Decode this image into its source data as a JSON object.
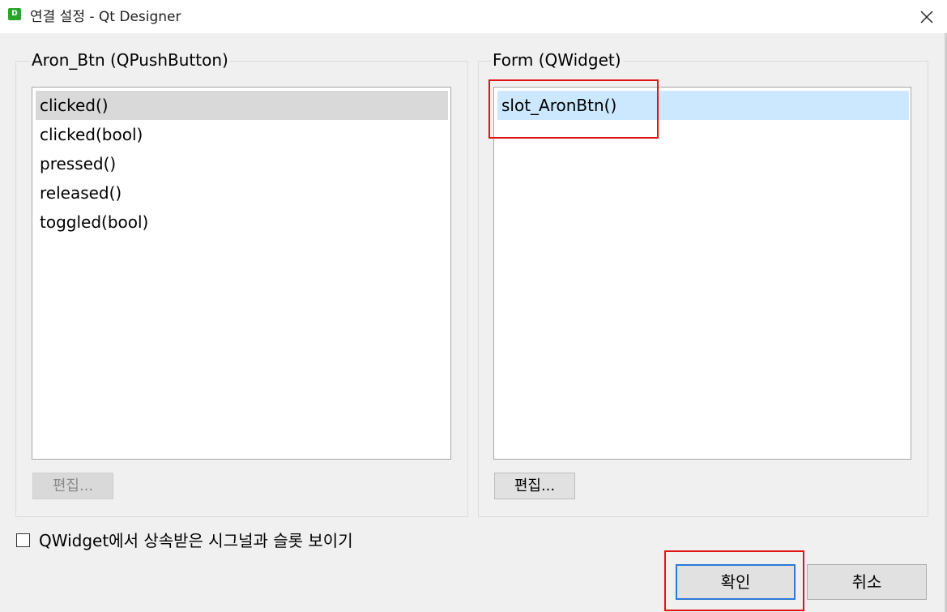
{
  "window": {
    "title": "연결 설정 - Qt Designer",
    "icon_letter": "D",
    "close_icon": "close-icon"
  },
  "sender": {
    "group_title": "Aron_Btn (QPushButton)",
    "signals": [
      "clicked()",
      "clicked(bool)",
      "pressed()",
      "released()",
      "toggled(bool)"
    ],
    "selected": "clicked()",
    "edit_label": "편집...",
    "edit_enabled": false
  },
  "receiver": {
    "group_title": "Form (QWidget)",
    "slots": [
      "slot_AronBtn()"
    ],
    "selected": "slot_AronBtn()",
    "edit_label": "편집...",
    "edit_enabled": true
  },
  "options": {
    "show_inherited_label": "QWidget에서 상속받은 시그널과 슬롯 보이기",
    "show_inherited_checked": false
  },
  "buttons": {
    "ok_label": "확인",
    "cancel_label": "취소"
  },
  "colors": {
    "selection_gray": "#d9d9d9",
    "selection_blue": "#cce8ff",
    "annotation_red": "#e11414",
    "default_button_border": "#2a7ad6"
  }
}
